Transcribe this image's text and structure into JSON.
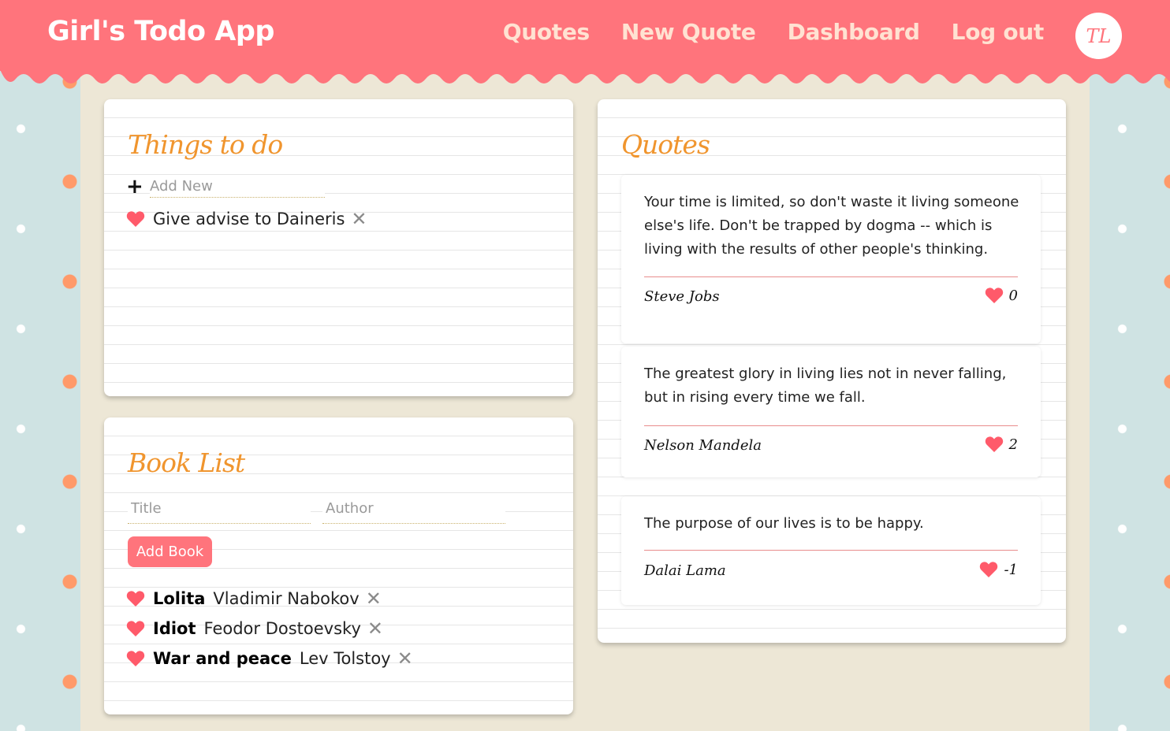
{
  "header": {
    "brand": "Girl's Todo App",
    "nav": [
      "Quotes",
      "New Quote",
      "Dashboard",
      "Log out"
    ],
    "avatar": "TL",
    "color": "#ff747c"
  },
  "todo": {
    "title": "Things to do",
    "add_placeholder": "Add New",
    "items": [
      {
        "text": "Give advise to Daineris"
      }
    ]
  },
  "books": {
    "title": "Book List",
    "title_placeholder": "Title",
    "author_placeholder": "Author",
    "add_button": "Add Book",
    "items": [
      {
        "title": "Lolita",
        "author": "Vladimir Nabokov"
      },
      {
        "title": "Idiot",
        "author": "Feodor Dostoevsky"
      },
      {
        "title": "War and peace",
        "author": "Lev Tolstoy"
      }
    ]
  },
  "quotes": {
    "title": "Quotes",
    "items": [
      {
        "text": "Your time is limited, so don't waste it living someone else's life. Don't be trapped by dogma -- which is living with the results of other people's thinking.",
        "author": "Steve Jobs",
        "likes": "0"
      },
      {
        "text": "The greatest glory in living lies not in never falling, but in rising every time we fall.",
        "author": "Nelson Mandela",
        "likes": "2"
      },
      {
        "text": "The purpose of our lives is to be happy.",
        "author": "Dalai Lama",
        "likes": "-1"
      }
    ]
  },
  "icons": {
    "heart": "heart-icon",
    "delete": "close-icon",
    "add": "plus-icon"
  },
  "colors": {
    "accent": "#f0952e",
    "heart": "#ff5a6a",
    "background": "#ede7d6"
  }
}
